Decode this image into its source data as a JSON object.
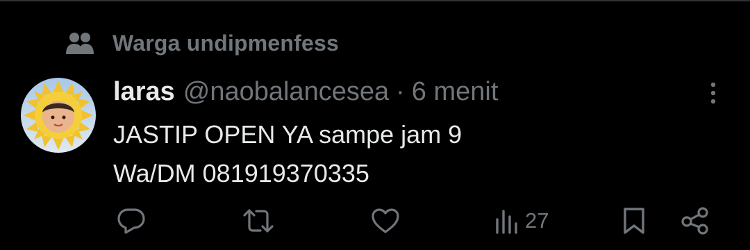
{
  "community": {
    "icon": "community-icon",
    "label": "Warga undipmenfess"
  },
  "tweet": {
    "author": {
      "display_name": "laras",
      "handle": "@naobalancesea",
      "avatar_icon": "sunflower-avatar"
    },
    "separator": "·",
    "time": "6 menit",
    "text_lines": [
      "JASTIP OPEN YA sampe jam 9",
      "Wa/DM 081919370335"
    ]
  },
  "actions": {
    "reply": {
      "icon": "reply-icon"
    },
    "retweet": {
      "icon": "retweet-icon"
    },
    "like": {
      "icon": "like-icon"
    },
    "views": {
      "icon": "views-icon",
      "count": "27"
    },
    "bookmark": {
      "icon": "bookmark-icon"
    },
    "share": {
      "icon": "share-icon"
    }
  },
  "colors": {
    "background": "#000000",
    "primary_text": "#e7e9ea",
    "secondary_text": "#71767b",
    "divider": "#2f3336"
  }
}
